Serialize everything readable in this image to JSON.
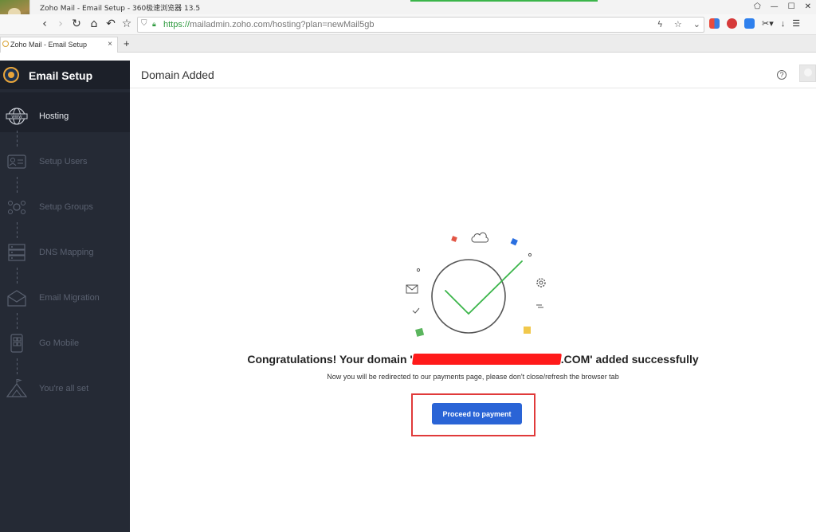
{
  "browser": {
    "window_title": "Zoho Mail - Email Setup - 360极速浏览器 13.5",
    "url_secure": "https://",
    "url_rest": "mailadmin.zoho.com/hosting?plan=newMail5gb",
    "tab_title": "Zoho Mail - Email Setup",
    "tab_close": "×",
    "new_tab": "+",
    "win_controls": [
      "⬠",
      "—",
      "☐",
      "✕"
    ]
  },
  "sidebar": {
    "brand": "Email Setup",
    "steps": [
      {
        "label": "Hosting",
        "icon": "www-globe-icon",
        "active": true
      },
      {
        "label": "Setup Users",
        "icon": "user-card-icon",
        "active": false
      },
      {
        "label": "Setup Groups",
        "icon": "group-icon",
        "active": false
      },
      {
        "label": "DNS Mapping",
        "icon": "server-icon",
        "active": false
      },
      {
        "label": "Email Migration",
        "icon": "envelope-icon",
        "active": false
      },
      {
        "label": "Go Mobile",
        "icon": "mobile-icon",
        "active": false
      },
      {
        "label": "You're all set",
        "icon": "mountain-flag-icon",
        "active": false
      }
    ]
  },
  "header": {
    "title": "Domain Added",
    "help": "?"
  },
  "main": {
    "congrats_prefix": "Congratulations! Your domain '",
    "congrats_suffix": ".COM' added successfully",
    "subtext": "Now you will be redirected to our payments page, please don't close/refresh the browser tab",
    "button_label": "Proceed to payment"
  },
  "colors": {
    "sidebar_bg": "#252a35",
    "accent_button": "#2a64d6",
    "check_green": "#3bb54a",
    "highlight_red": "#e03a3a"
  }
}
